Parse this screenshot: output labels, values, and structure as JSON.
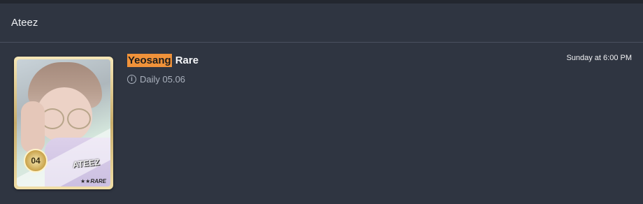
{
  "panel": {
    "title": "Ateez"
  },
  "item": {
    "name": "Yeosang",
    "rarity": "Rare",
    "source": "Daily 05.06",
    "timestamp": "Sunday at 6:00 PM",
    "card": {
      "number": "04",
      "group": "ATEEZ",
      "rarity_label": "★★RARE"
    }
  },
  "colors": {
    "background": "#2f3541",
    "highlight": "#f0923a"
  }
}
